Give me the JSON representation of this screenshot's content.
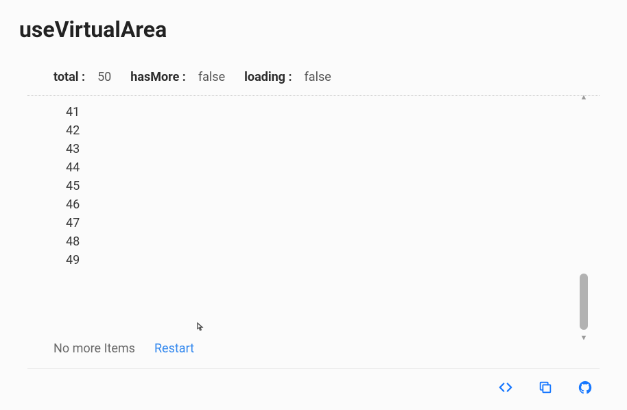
{
  "title": "useVirtualArea",
  "status": {
    "total_label": "total :",
    "total_value": "50",
    "hasMore_label": "hasMore :",
    "hasMore_value": "false",
    "loading_label": "loading :",
    "loading_value": "false"
  },
  "items": [
    "41",
    "42",
    "43",
    "44",
    "45",
    "46",
    "47",
    "48",
    "49"
  ],
  "footer": {
    "no_more": "No more Items",
    "restart": "Restart"
  },
  "toolbar": {
    "code_icon": "code-icon",
    "copy_icon": "copy-icon",
    "github_icon": "github-icon"
  },
  "colors": {
    "link": "#3388ee",
    "primary": "#1677ff",
    "text": "#333"
  }
}
